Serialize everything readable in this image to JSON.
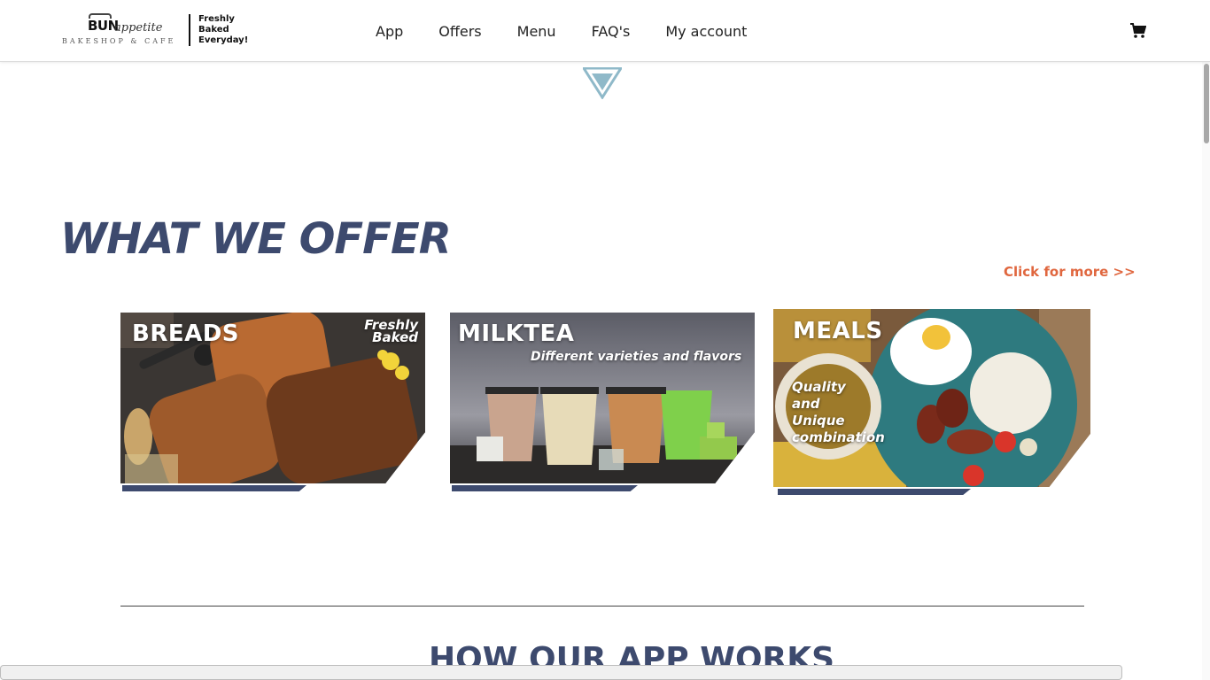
{
  "header": {
    "logo": {
      "name_main": "BUN",
      "name_script": "appetite",
      "subtitle": "BAKESHOP & CAFE",
      "tagline": [
        "Freshly",
        "Baked",
        "Everyday!"
      ]
    },
    "nav": [
      "App",
      "Offers",
      "Menu",
      "FAQ's",
      "My account"
    ],
    "cart_icon": "shopping-cart-icon"
  },
  "offers": {
    "title": "WHAT WE OFFER",
    "more_link": "Click for more >>",
    "cards": [
      {
        "title": "BREADS",
        "tag": [
          "Freshly",
          "Baked"
        ]
      },
      {
        "title": "MILKTEA",
        "tag": [
          "Different varieties and flavors"
        ]
      },
      {
        "title": "MEALS",
        "tag": [
          "Quality",
          "and",
          "Unique",
          "combination"
        ]
      }
    ]
  },
  "how_it_works": {
    "title": "HOW OUR APP WORKS"
  },
  "colors": {
    "navy": "#3d4a6e",
    "accent": "#e0673f",
    "arrow": "#8fb9c9"
  }
}
